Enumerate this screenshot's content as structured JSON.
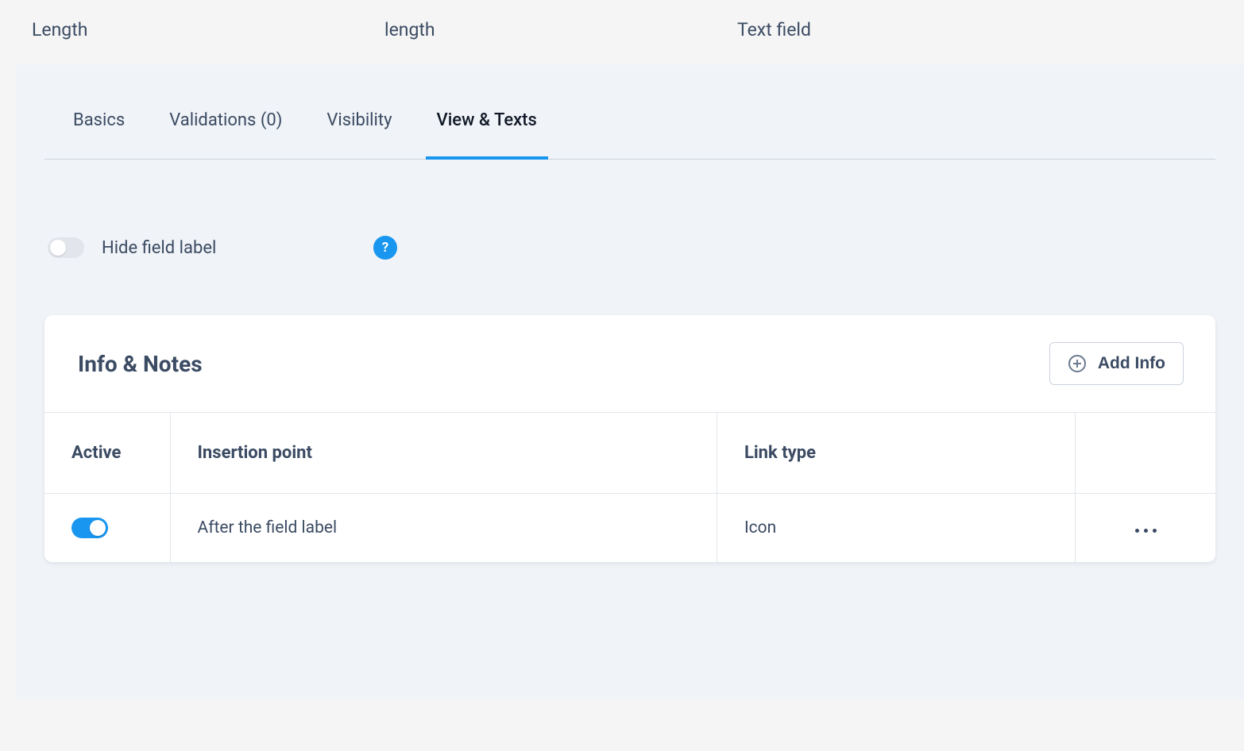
{
  "header": {
    "field_label": "Length",
    "field_identifier": "length",
    "field_type": "Text field"
  },
  "tabs": {
    "basics": "Basics",
    "validations": "Validations (0)",
    "visibility": "Visibility",
    "view_texts": "View & Texts"
  },
  "hide_field_label": {
    "label": "Hide field label",
    "help_icon": "?"
  },
  "info_notes": {
    "title": "Info & Notes",
    "add_button": "Add Info",
    "columns": {
      "active": "Active",
      "insertion_point": "Insertion point",
      "link_type": "Link type"
    },
    "rows": [
      {
        "active": true,
        "insertion_point": "After the field label",
        "link_type": "Icon"
      }
    ]
  }
}
